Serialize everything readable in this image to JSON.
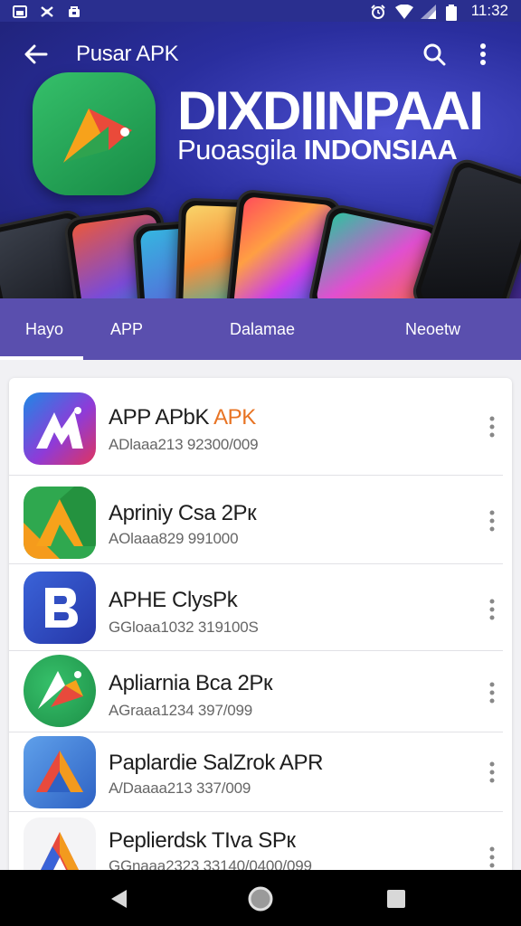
{
  "status_bar": {
    "time": "11:32",
    "left_icons": [
      "image-icon",
      "settings-icon",
      "bag-icon"
    ],
    "right_icons": [
      "alarm-icon",
      "wifi-icon",
      "signal-icon",
      "battery-icon"
    ]
  },
  "app_bar": {
    "title": "Pusar APK"
  },
  "hero": {
    "headline": "DIXDIINPAAI",
    "subline_prefix": "Puoasgila",
    "subline_bold": "INDONSIAA"
  },
  "tabs": [
    {
      "label": "Hayo",
      "selected": true
    },
    {
      "label": "APP",
      "selected": false
    },
    {
      "label": "Dalamae",
      "selected": false
    },
    {
      "label": "Neoetw",
      "selected": false
    }
  ],
  "apps": [
    {
      "name": "APP APbK",
      "name_accent": "APK",
      "meta": "ADlaaa213   92300/009",
      "icon": "app-a-icon"
    },
    {
      "name": "Apriniy Csa 2Pк",
      "name_accent": "",
      "meta": "AOlaaa829   991000",
      "icon": "app-triangle-icon"
    },
    {
      "name": "APHE ClysPk",
      "name_accent": "",
      "meta": "GGloaa1032   319100S",
      "icon": "app-b-icon"
    },
    {
      "name": "Apliarnia Bca 2Pк",
      "name_accent": "",
      "meta": "AGraaa1234   397/099",
      "icon": "app-arrow-icon"
    },
    {
      "name": "Paplardie SalZrok APR",
      "name_accent": "",
      "meta": "A/Daaaa213   337/009",
      "icon": "app-delta-icon"
    },
    {
      "name": "Peplierdsk TIva SPк",
      "name_accent": "",
      "meta": "GGnaaa2323   33140/0400/099",
      "icon": "app-prism-icon"
    }
  ],
  "nav_bar": {
    "buttons": [
      "back-triangle-icon",
      "home-circle-icon",
      "recents-square-icon"
    ]
  },
  "colors": {
    "status_bar": "#2a2f8f",
    "hero_bg": "#2a2e9e",
    "tabs_bg": "#5a4fae",
    "accent_orange": "#e87424"
  }
}
